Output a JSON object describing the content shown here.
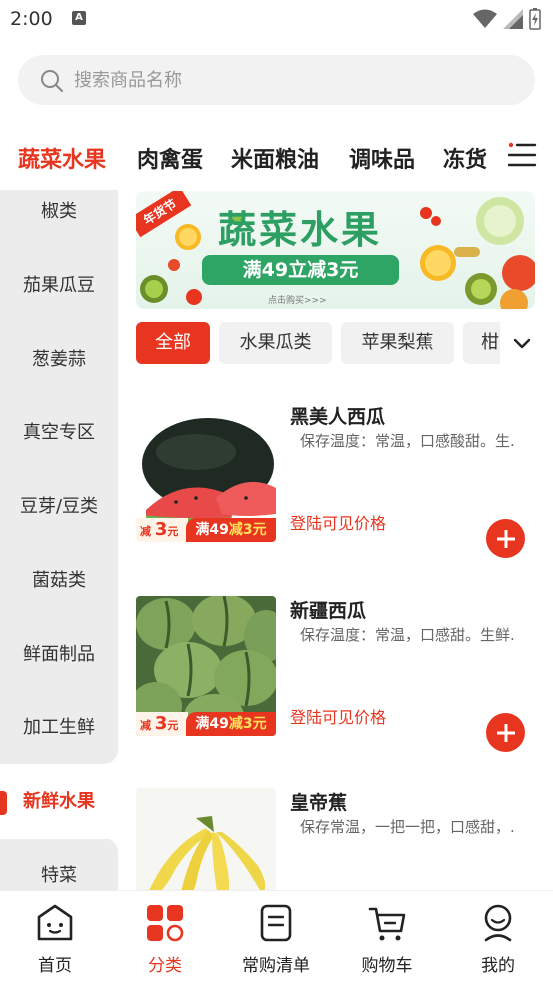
{
  "status_bar": {
    "time": "2:00",
    "notification_letter": "A"
  },
  "search": {
    "placeholder": "搜索商品名称"
  },
  "category_tabs": [
    {
      "label": "蔬菜水果",
      "active": true
    },
    {
      "label": "肉禽蛋",
      "active": false
    },
    {
      "label": "米面粮油",
      "active": false
    },
    {
      "label": "调味品",
      "active": false
    },
    {
      "label": "冻货",
      "active": false
    }
  ],
  "sidebar": {
    "items": [
      {
        "label": "椒类"
      },
      {
        "label": "茄果瓜豆"
      },
      {
        "label": "葱姜蒜"
      },
      {
        "label": "真空专区"
      },
      {
        "label": "豆芽/豆类"
      },
      {
        "label": "菌菇类"
      },
      {
        "label": "鲜面制品"
      },
      {
        "label": "加工生鲜"
      },
      {
        "label": "新鲜水果",
        "active": true
      },
      {
        "label": "特菜"
      }
    ]
  },
  "banner": {
    "tag": "年货节",
    "title": "蔬菜水果",
    "subtitle": "满49立减3元",
    "footnote": "点击购买>>>"
  },
  "chips": [
    {
      "label": "全部",
      "active": true
    },
    {
      "label": "水果瓜类"
    },
    {
      "label": "苹果梨蕉"
    },
    {
      "label": "柑"
    }
  ],
  "products": [
    {
      "name": "黑美人西瓜",
      "desc": "保存温度：常温，口感酸甜。生.",
      "price": "登陆可见价格",
      "promo_left_prefix": "减",
      "promo_left_num": "3",
      "promo_left_unit": "元",
      "promo_right_a": "满49",
      "promo_right_b": "减3元"
    },
    {
      "name": "新疆西瓜",
      "desc": "保存温度：常温，口感甜。生鲜.",
      "price": "登陆可见价格",
      "promo_left_prefix": "减",
      "promo_left_num": "3",
      "promo_left_unit": "元",
      "promo_right_a": "满49",
      "promo_right_b": "减3元"
    },
    {
      "name": "皇帝蕉",
      "desc": "保存常温，一把一把，口感甜，."
    }
  ],
  "bottom_nav": [
    {
      "label": "首页",
      "icon": "home-face-icon"
    },
    {
      "label": "分类",
      "icon": "category-grid-icon",
      "active": true
    },
    {
      "label": "常购清单",
      "icon": "list-icon"
    },
    {
      "label": "购物车",
      "icon": "cart-icon"
    },
    {
      "label": "我的",
      "icon": "profile-icon"
    }
  ],
  "colors": {
    "accent": "#e8351f",
    "banner_green": "#2e9f62"
  }
}
